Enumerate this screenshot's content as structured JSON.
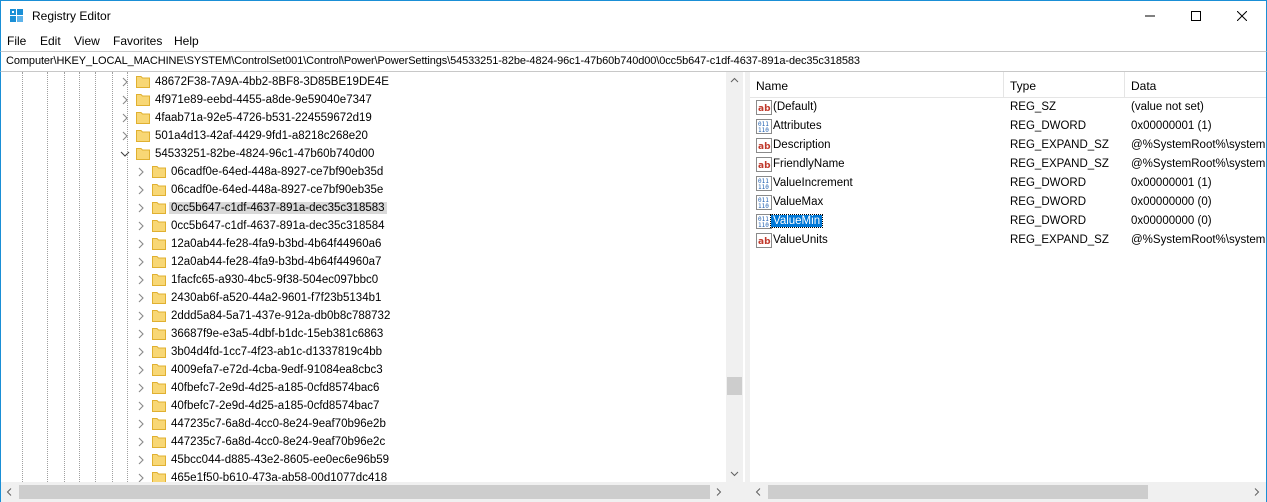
{
  "window": {
    "title": "Registry Editor",
    "minimize_icon": "minimize-icon",
    "maximize_icon": "maximize-icon",
    "close_icon": "close-icon"
  },
  "menu": [
    "File",
    "Edit",
    "View",
    "Favorites",
    "Help"
  ],
  "address": "Computer\\HKEY_LOCAL_MACHINE\\SYSTEM\\ControlSet001\\Control\\Power\\PowerSettings\\54533251-82be-4824-96c1-47b60b740d00\\0cc5b647-c1df-4637-891a-dec35c318583",
  "tree": {
    "rows": [
      {
        "label": "48672F38-7A9A-4bb2-8BF8-3D85BE19DE4E",
        "level": 1,
        "expanded": false,
        "selected": false
      },
      {
        "label": "4f971e89-eebd-4455-a8de-9e59040e7347",
        "level": 1,
        "expanded": false,
        "selected": false
      },
      {
        "label": "4faab71a-92e5-4726-b531-224559672d19",
        "level": 1,
        "expanded": false,
        "selected": false
      },
      {
        "label": "501a4d13-42af-4429-9fd1-a8218c268e20",
        "level": 1,
        "expanded": false,
        "selected": false
      },
      {
        "label": "54533251-82be-4824-96c1-47b60b740d00",
        "level": 1,
        "expanded": true,
        "selected": false
      },
      {
        "label": "06cadf0e-64ed-448a-8927-ce7bf90eb35d",
        "level": 2,
        "expanded": false,
        "selected": false
      },
      {
        "label": "06cadf0e-64ed-448a-8927-ce7bf90eb35e",
        "level": 2,
        "expanded": false,
        "selected": false
      },
      {
        "label": "0cc5b647-c1df-4637-891a-dec35c318583",
        "level": 2,
        "expanded": false,
        "selected": true
      },
      {
        "label": "0cc5b647-c1df-4637-891a-dec35c318584",
        "level": 2,
        "expanded": false,
        "selected": false
      },
      {
        "label": "12a0ab44-fe28-4fa9-b3bd-4b64f44960a6",
        "level": 2,
        "expanded": false,
        "selected": false
      },
      {
        "label": "12a0ab44-fe28-4fa9-b3bd-4b64f44960a7",
        "level": 2,
        "expanded": false,
        "selected": false
      },
      {
        "label": "1facfc65-a930-4bc5-9f38-504ec097bbc0",
        "level": 2,
        "expanded": false,
        "selected": false
      },
      {
        "label": "2430ab6f-a520-44a2-9601-f7f23b5134b1",
        "level": 2,
        "expanded": false,
        "selected": false
      },
      {
        "label": "2ddd5a84-5a71-437e-912a-db0b8c788732",
        "level": 2,
        "expanded": false,
        "selected": false
      },
      {
        "label": "36687f9e-e3a5-4dbf-b1dc-15eb381c6863",
        "level": 2,
        "expanded": false,
        "selected": false
      },
      {
        "label": "3b04d4fd-1cc7-4f23-ab1c-d1337819c4bb",
        "level": 2,
        "expanded": false,
        "selected": false
      },
      {
        "label": "4009efa7-e72d-4cba-9edf-91084ea8cbc3",
        "level": 2,
        "expanded": false,
        "selected": false
      },
      {
        "label": "40fbefc7-2e9d-4d25-a185-0cfd8574bac6",
        "level": 2,
        "expanded": false,
        "selected": false
      },
      {
        "label": "40fbefc7-2e9d-4d25-a185-0cfd8574bac7",
        "level": 2,
        "expanded": false,
        "selected": false
      },
      {
        "label": "447235c7-6a8d-4cc0-8e24-9eaf70b96e2b",
        "level": 2,
        "expanded": false,
        "selected": false
      },
      {
        "label": "447235c7-6a8d-4cc0-8e24-9eaf70b96e2c",
        "level": 2,
        "expanded": false,
        "selected": false
      },
      {
        "label": "45bcc044-d885-43e2-8605-ee0ec6e96b59",
        "level": 2,
        "expanded": false,
        "selected": false
      },
      {
        "label": "465e1f50-b610-473a-ab58-00d1077dc418",
        "level": 2,
        "expanded": false,
        "selected": false
      }
    ]
  },
  "list": {
    "columns": [
      "Name",
      "Type",
      "Data"
    ],
    "rows": [
      {
        "name": "(Default)",
        "type": "REG_SZ",
        "data": "(value not set)",
        "icon": "string-value-icon",
        "selected": false
      },
      {
        "name": "Attributes",
        "type": "REG_DWORD",
        "data": "0x00000001 (1)",
        "icon": "binary-value-icon",
        "selected": false
      },
      {
        "name": "Description",
        "type": "REG_EXPAND_SZ",
        "data": "@%SystemRoot%\\system",
        "icon": "string-value-icon",
        "selected": false
      },
      {
        "name": "FriendlyName",
        "type": "REG_EXPAND_SZ",
        "data": "@%SystemRoot%\\system",
        "icon": "string-value-icon",
        "selected": false
      },
      {
        "name": "ValueIncrement",
        "type": "REG_DWORD",
        "data": "0x00000001 (1)",
        "icon": "binary-value-icon",
        "selected": false
      },
      {
        "name": "ValueMax",
        "type": "REG_DWORD",
        "data": "0x00000000 (0)",
        "icon": "binary-value-icon",
        "selected": false
      },
      {
        "name": "ValueMin",
        "type": "REG_DWORD",
        "data": "0x00000000 (0)",
        "icon": "binary-value-icon",
        "selected": true
      },
      {
        "name": "ValueUnits",
        "type": "REG_EXPAND_SZ",
        "data": "@%SystemRoot%\\system",
        "icon": "string-value-icon",
        "selected": false
      }
    ]
  },
  "colors": {
    "accent_border": "#1a8fd6",
    "selection_blue": "#0078d7",
    "selection_gray": "#d9d9d9",
    "folder_yellow": "#f8d775",
    "folder_dark": "#e0b030"
  }
}
